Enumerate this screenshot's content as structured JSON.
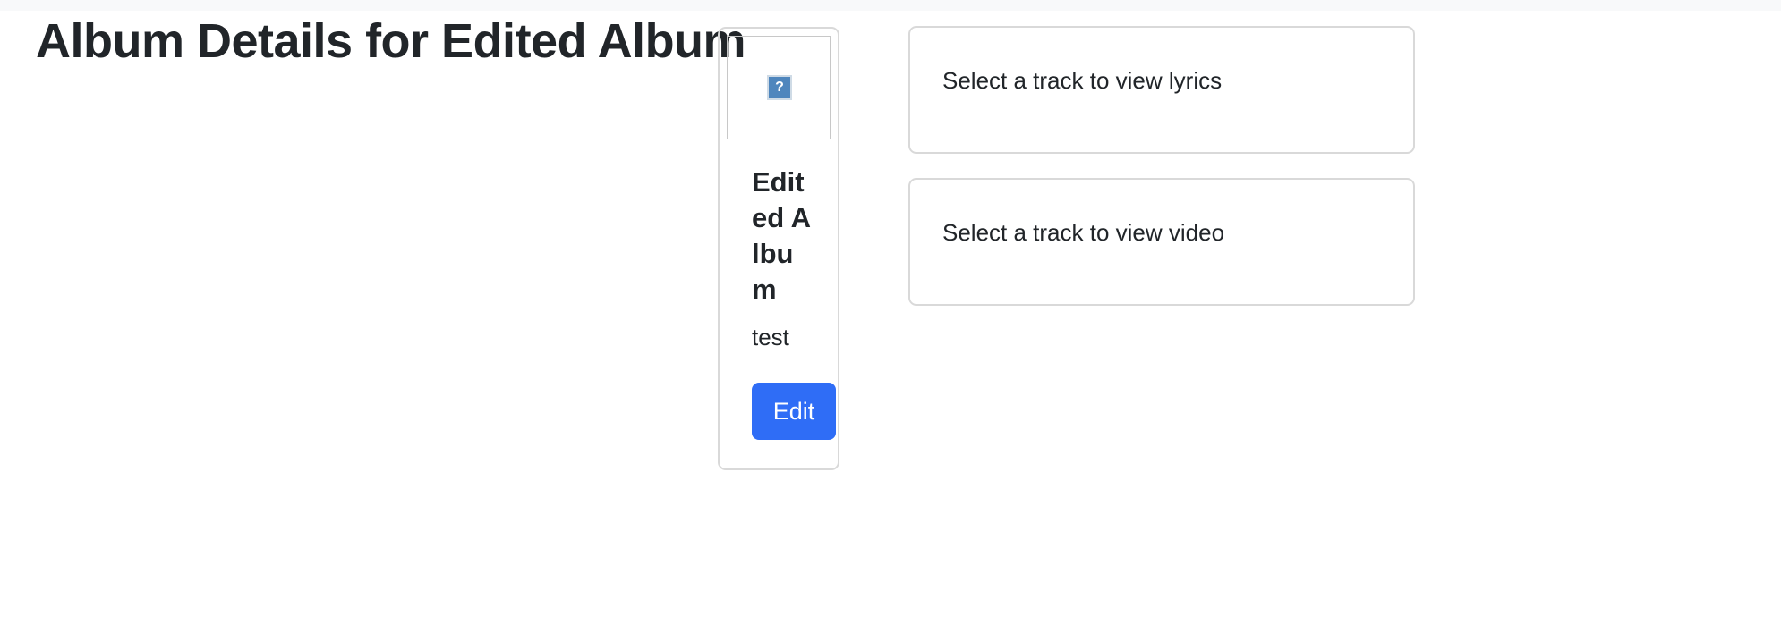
{
  "page": {
    "title": "Album Details for Edited Album"
  },
  "album": {
    "cover_icon": "missing-image-icon",
    "cover_icon_glyph": "?",
    "title": "Edited Album",
    "artist": "test",
    "edit_label": "Edit"
  },
  "lyrics_panel": {
    "message": "Select a track to view lyrics"
  },
  "video_panel": {
    "message": "Select a track to view video"
  },
  "colors": {
    "primary_button": "#2f6df6",
    "border": "#d9d9d9",
    "text": "#212529"
  }
}
